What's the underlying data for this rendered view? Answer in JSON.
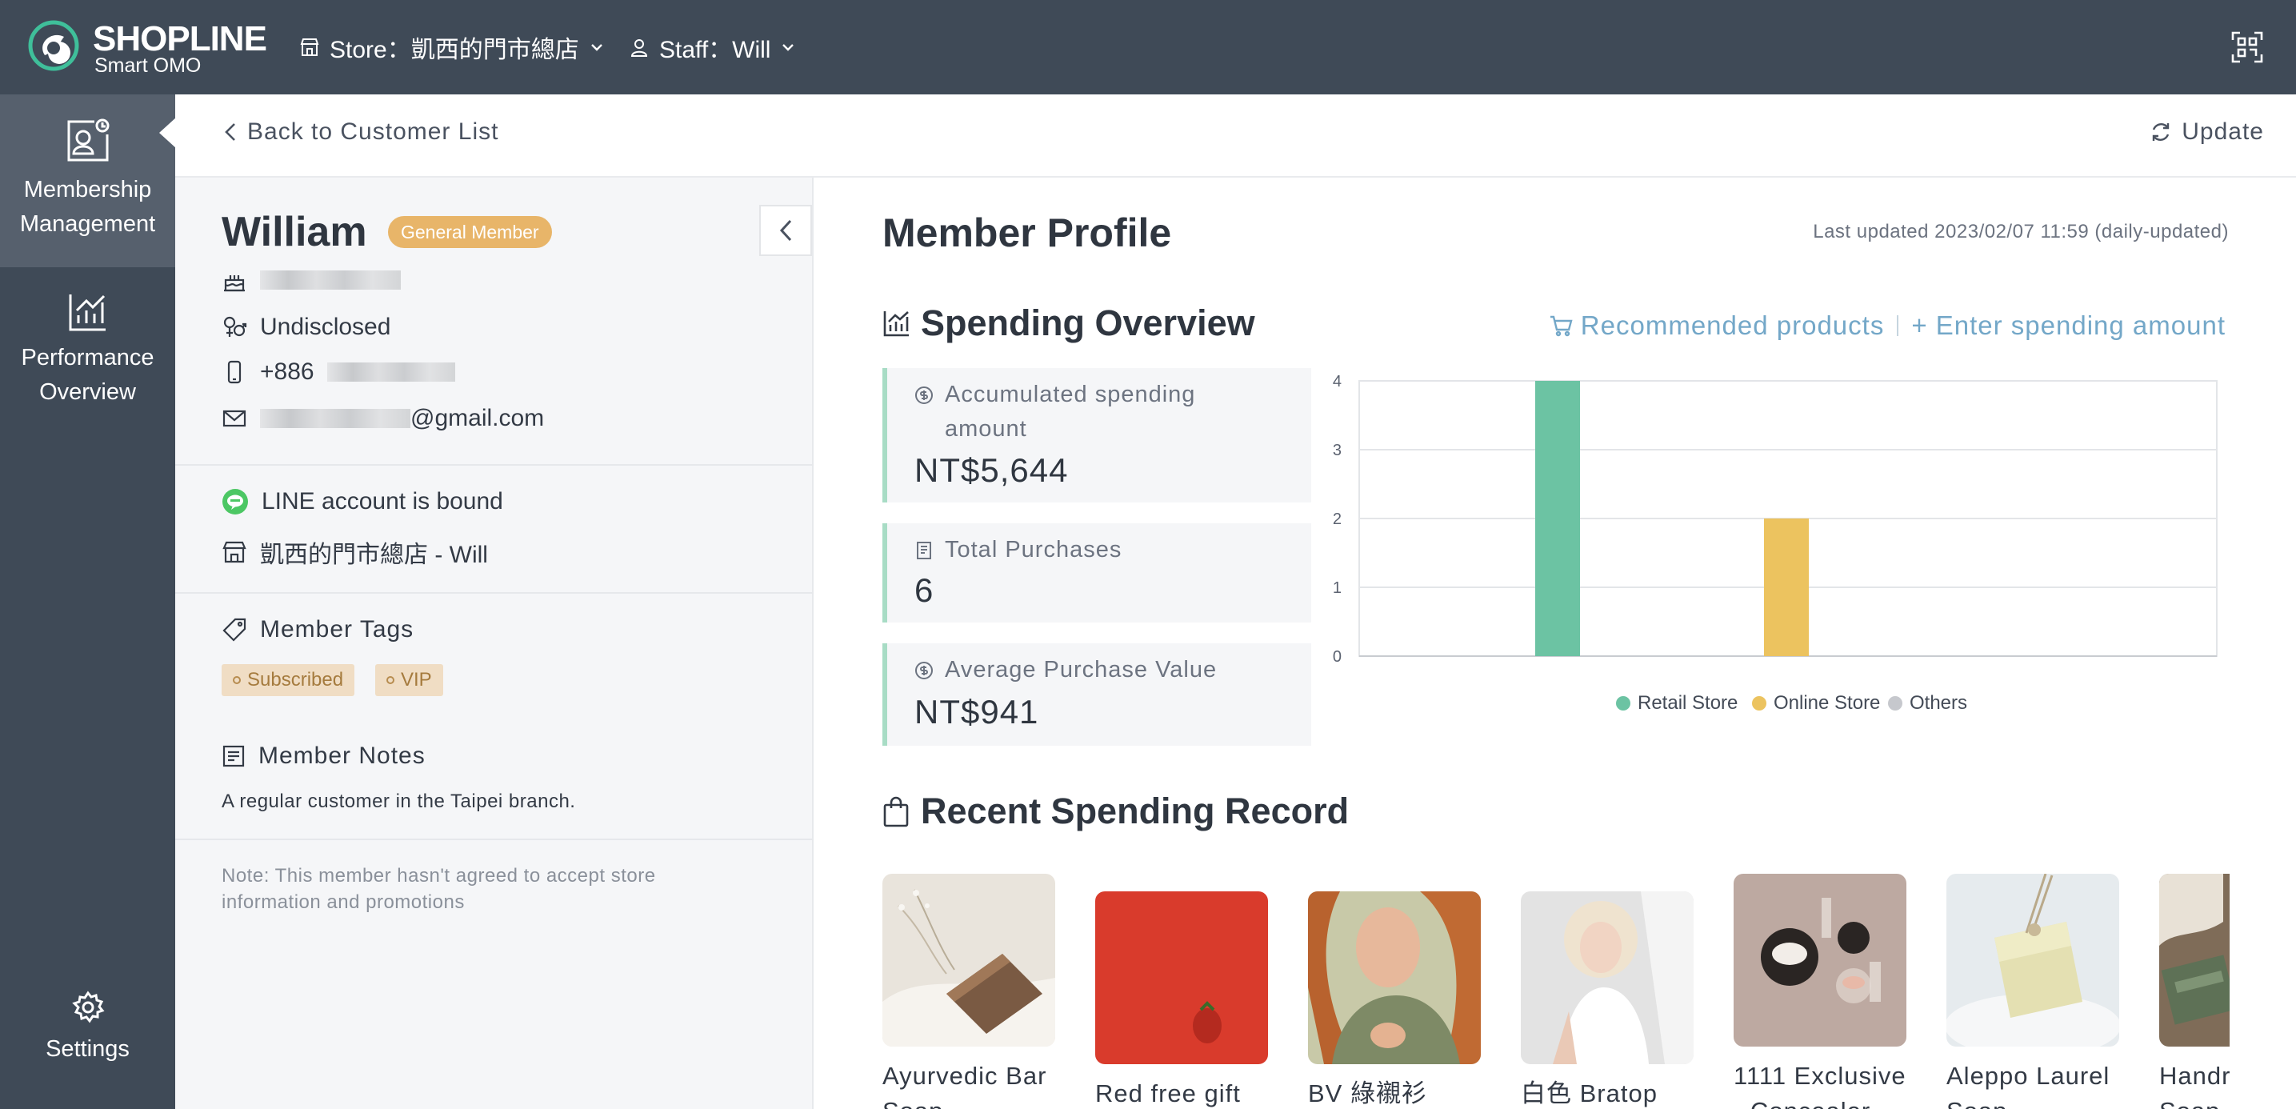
{
  "topbar": {
    "brand": "SHOPLINE",
    "brand_sub": "Smart OMO",
    "store_label": "Store：凱西的門市總店",
    "staff_label": "Staff：Will"
  },
  "sidenav": {
    "items": [
      {
        "label_line1": "Membership",
        "label_line2": "Management"
      },
      {
        "label_line1": "Performance",
        "label_line2": "Overview"
      },
      {
        "label_line1": "Settings"
      }
    ]
  },
  "header": {
    "back_label": "Back to Customer List",
    "update_label": "Update"
  },
  "member": {
    "name": "William",
    "level": "General Member",
    "gender": "Undisclosed",
    "phone_prefix": "+886",
    "email_suffix": "@gmail.com",
    "line_status": "LINE account is bound",
    "store_staff": "凱西的門市總店 - Will",
    "tags_title": "Member Tags",
    "tags": [
      "Subscribed",
      "VIP"
    ],
    "notes_title": "Member Notes",
    "notes": "A regular customer in the Taipei branch.",
    "promo_note": "Note: This member hasn't agreed to accept store information and promotions"
  },
  "profile": {
    "title": "Member Profile",
    "last_updated": "Last updated 2023/02/07 11:59 (daily-updated)",
    "spending_title": "Spending Overview",
    "recommended_label": "Recommended products",
    "enter_amount_label": "+ Enter spending amount",
    "stats": [
      {
        "label_line1": "Accumulated spending",
        "label_line2": "amount",
        "value": "NT$5,644"
      },
      {
        "label_line1": "Total Purchases",
        "value": "6"
      },
      {
        "label_line1": "Average Purchase Value",
        "value": "NT$941"
      }
    ],
    "recent_title": "Recent Spending Record",
    "products": [
      {
        "line1": "Ayurvedic Bar",
        "line2": "Soap"
      },
      {
        "line1": "Red free gift",
        "line2": ""
      },
      {
        "line1": "BV 綠襯衫",
        "line2": ""
      },
      {
        "line1": "白色 Bratop",
        "line2": ""
      },
      {
        "line1": "1111 Exclusive",
        "line2": "- Concealer"
      },
      {
        "line1": "Aleppo Laurel",
        "line2": "Soap"
      },
      {
        "line1": "Handr",
        "line2": "Soap"
      }
    ]
  },
  "colors": {
    "retail": "#6cc3a3",
    "online": "#ecc35f",
    "others": "#c6c8cd",
    "accent": "#73a7c8"
  },
  "chart_data": {
    "type": "bar",
    "categories": [
      "Retail Store",
      "Online Store",
      "Others"
    ],
    "series": [
      {
        "name": "",
        "values": [
          4,
          2,
          0
        ]
      }
    ],
    "legend": [
      "Retail Store",
      "Online Store",
      "Others"
    ],
    "yticks": [
      0,
      1,
      2,
      3,
      4
    ],
    "ylim": [
      0,
      4
    ],
    "grid": true,
    "legend_position": "bottom"
  }
}
